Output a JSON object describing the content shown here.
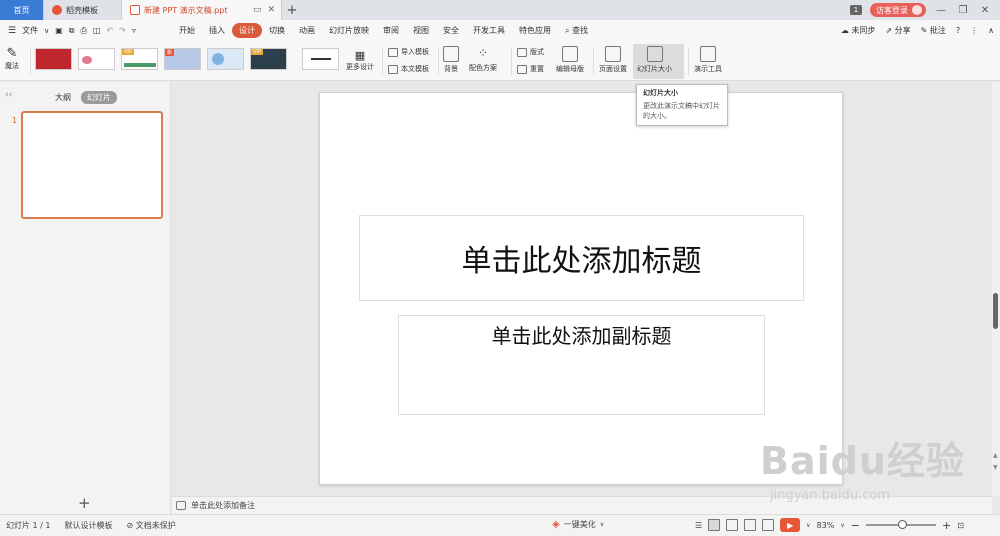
{
  "titlebar": {
    "tabs": [
      {
        "label": "首页"
      },
      {
        "label": "稻壳模板"
      },
      {
        "label": "新建 PPT 演示文稿.ppt"
      }
    ],
    "page_indicator": "1",
    "login_label": "访客登录"
  },
  "menu": {
    "file_label": "文件",
    "items": [
      "开始",
      "插入",
      "设计",
      "切换",
      "动画",
      "幻灯片放映",
      "审阅",
      "视图",
      "安全",
      "开发工具",
      "特色应用"
    ],
    "active_index": 2,
    "search_label": "查找",
    "sync_label": "未同步",
    "share_label": "分享",
    "comment_label": "批注"
  },
  "ribbon": {
    "magic_label": "魔法",
    "more_designs_label": "更多设计",
    "import_template_label": "导入模板",
    "this_doc_template_label": "本文模板",
    "background_label": "背景",
    "color_scheme_label": "配色方案",
    "layout_label": "版式",
    "reset_label": "重置",
    "edit_master_label": "编辑母版",
    "page_setup_label": "页面设置",
    "slide_size_label": "幻灯片大小",
    "present_tools_label": "演示工具"
  },
  "tooltip": {
    "title": "幻灯片大小",
    "description": "更改此演示文稿中幻灯片的大小。"
  },
  "left_panel": {
    "outline_label": "大纲",
    "slides_label": "幻灯片",
    "slide_number": "1"
  },
  "slide": {
    "title_placeholder": "单击此处添加标题",
    "subtitle_placeholder": "单击此处添加副标题"
  },
  "notes": {
    "placeholder": "单击此处添加备注"
  },
  "statusbar": {
    "slide_counter": "幻灯片 1 / 1",
    "design_template": "默认设计模板",
    "protection": "文档未保护",
    "beautify_label": "一键美化",
    "zoom_label": "83%",
    "zoom_value": 0.83
  },
  "watermark": {
    "brand": "Baidu经验",
    "url": "jingyan.baidu.com"
  },
  "colors": {
    "accent": "#d85a3a",
    "home_tab": "#3a7bd5",
    "login": "#e8605a"
  }
}
